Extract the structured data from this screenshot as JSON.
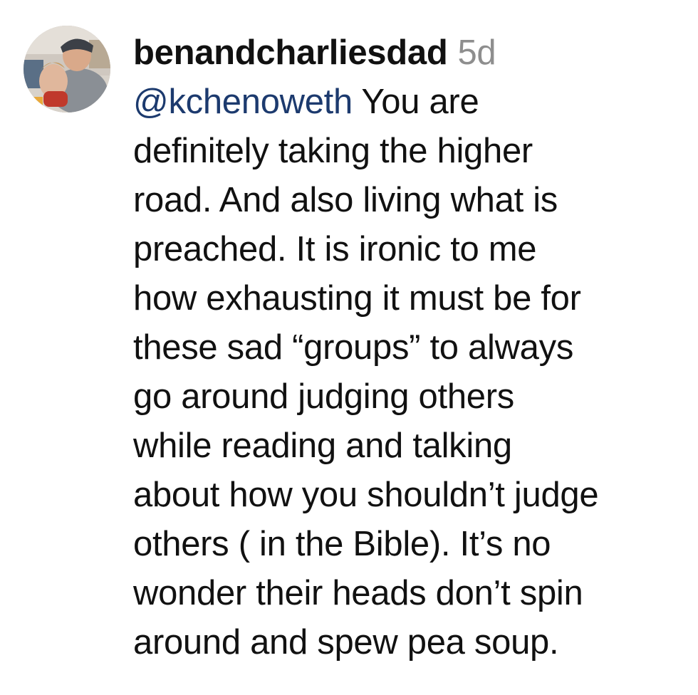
{
  "comment": {
    "username": "benandcharliesdad",
    "timestamp": "5d",
    "mention": "@kchenoweth",
    "text_lines": [
      " You are",
      "definitely taking the higher",
      "road. And also living what is",
      "preached. It is ironic to me",
      "how exhausting it must be for",
      "these sad “groups” to always",
      "go around judging others",
      "while reading and talking",
      "about how you shouldn’t judge",
      "others ( in the Bible). It’s no",
      "wonder their heads don’t spin",
      "around and spew pea soup."
    ]
  },
  "colors": {
    "username": "#111111",
    "timestamp": "#8e8e8e",
    "mention": "#1c3a6e",
    "text": "#111111"
  },
  "icons": {
    "avatar": "profile-photo-avatar"
  }
}
